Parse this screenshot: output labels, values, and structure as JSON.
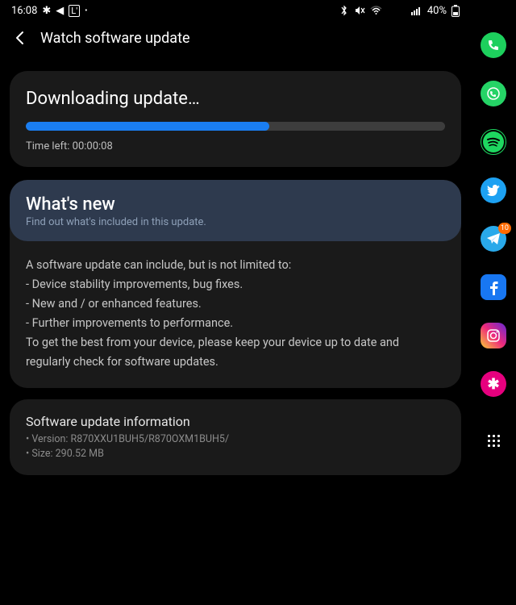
{
  "statusbar": {
    "time": "16:08",
    "battery_text": "40%"
  },
  "header": {
    "title": "Watch software update"
  },
  "download": {
    "title": "Downloading update…",
    "progress_percent": 58,
    "time_left_label": "Time left: 00:00:08"
  },
  "whats_new": {
    "title": "What's new",
    "subtitle": "Find out what's included in this update.",
    "body_intro": "A software update can include, but is not limited to:",
    "items": [
      " - Device stability improvements, bug fixes.",
      " - New and / or enhanced features.",
      " - Further improvements to performance."
    ],
    "body_outro": "To get the best from your device, please keep your device up to date and regularly check for software updates."
  },
  "info": {
    "title": "Software update information",
    "version_line": "• Version: R870XXU1BUH5/R870OXM1BUH5/",
    "size_line": "• Size: 290.52 MB"
  },
  "edge_badge": {
    "telegram": "10"
  }
}
